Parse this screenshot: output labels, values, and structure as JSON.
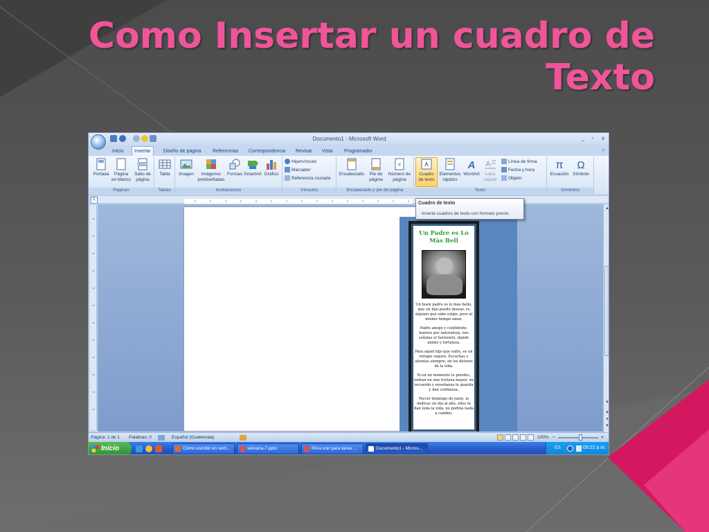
{
  "slide": {
    "title_line1": "Como Insertar un cuadro de",
    "title_line2": "Texto",
    "accent_color": "#f0559a"
  },
  "window": {
    "title": "Documento1 - Microsoft Word",
    "controls": [
      "_",
      "▫",
      "x"
    ]
  },
  "tabs": [
    "Inicio",
    "Insertar",
    "Diseño de página",
    "Referencias",
    "Correspondencia",
    "Revisar",
    "Vista",
    "Programador"
  ],
  "active_tab": "Insertar",
  "ribbon": {
    "paginas": {
      "label": "Páginas",
      "portada": "Portada",
      "pagina_en_blanco_1": "Página",
      "pagina_en_blanco_2": "en blanco",
      "salto_1": "Salto de",
      "salto_2": "página"
    },
    "tablas": {
      "label": "Tablas",
      "tabla": "Tabla"
    },
    "ilustraciones": {
      "label": "Ilustraciones",
      "imagen": "Imagen",
      "imagenes_1": "Imágenes",
      "imagenes_2": "prediseñadas",
      "formas": "Formas",
      "smartart": "SmartArt",
      "grafico": "Gráfico"
    },
    "vinculos": {
      "label": "Vínculos",
      "hipervinculo": "Hipervínculo",
      "marcador": "Marcador",
      "referencia": "Referencia cruzada"
    },
    "encabezado": {
      "label": "Encabezado y pie de página",
      "encabezado": "Encabezado",
      "pie_1": "Pie de",
      "pie_2": "página",
      "numero_1": "Número de",
      "numero_2": "página"
    },
    "texto": {
      "label": "Texto",
      "cuadro_1": "Cuadro",
      "cuadro_2": "de texto",
      "elementos_1": "Elementos",
      "elementos_2": "rápidos",
      "wordart": "WordArt",
      "letra_1": "Letra",
      "letra_2": "capital",
      "linea_firma": "Línea de firma",
      "fecha_hora": "Fecha y hora",
      "objeto": "Objeto"
    },
    "simbolos": {
      "label": "Símbolos",
      "ecuacion": "Ecuación",
      "simbolo": "Símbolo"
    }
  },
  "tooltip": {
    "title": "Cuadro de texto",
    "description": "Inserta cuadros de texto con formato previo."
  },
  "bookmark": {
    "title_1": "Un Padre es Lo",
    "title_2": "Más Bell",
    "stanzas": [
      "Un buen padre es lo más bello, que un hijo puede desear, es alguien que sabe exigir, pero al mismo tiempo amar.",
      "Padre amigo y confidente, buenos por naturaleza, nos señalas el horizonte, dando ánimo y fortaleza.",
      "Para aquel hijo que sufre, es un refugio seguro. Escuchas y alientas siempre, en los dolores de la vida.",
      "Si en un momento lo pierdes, entran en una tristeza mayor, en recuerdo y enseñanza te guarda y dan confianza.",
      "Tercer domingo de junio, le dedicas un día al año, ellos te dan toda la vida, no podrás nada a cambio."
    ]
  },
  "statusbar": {
    "pages": "Página: 1 de 1",
    "words": "Palabras: 0",
    "language": "Español (Guatemala)",
    "zoom": "100%"
  },
  "taskbar": {
    "start": "Inicio",
    "tasks": [
      "Cómo escribir en verti...",
      "semana-7.pptx",
      "PAra unir para tarea ...",
      "Documento1 - Micros..."
    ],
    "language": "ES",
    "clock": "09:22 p.m."
  }
}
